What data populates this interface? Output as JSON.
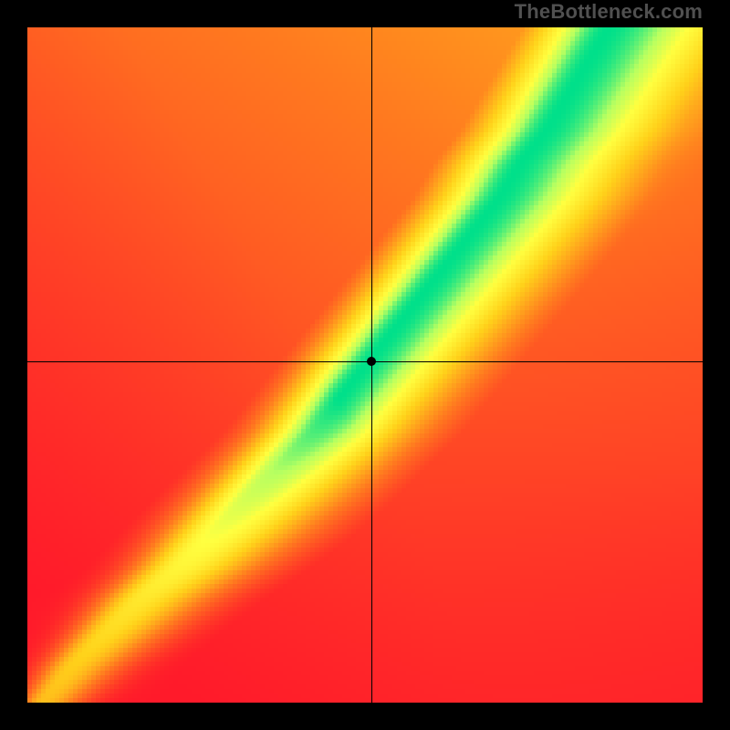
{
  "watermark": "TheBottleneck.com",
  "chart_data": {
    "type": "heatmap",
    "title": "",
    "xlabel": "",
    "ylabel": "",
    "xlim": [
      0,
      1
    ],
    "ylim": [
      0,
      1
    ],
    "crosshair": {
      "x": 0.51,
      "y": 0.505
    },
    "marker": {
      "x": 0.51,
      "y": 0.505
    },
    "grid": false,
    "legend": "none",
    "color_scale": {
      "stops": [
        {
          "value": 0.0,
          "color": "#FF1A2A"
        },
        {
          "value": 0.35,
          "color": "#FF7A1F"
        },
        {
          "value": 0.62,
          "color": "#FFD21A"
        },
        {
          "value": 0.8,
          "color": "#FFFF40"
        },
        {
          "value": 0.9,
          "color": "#B8FF60"
        },
        {
          "value": 1.0,
          "color": "#00E08A"
        }
      ]
    },
    "ridge": {
      "description": "Approximate center x of the green ridge as a function of y (0 at bottom, 1 at top)",
      "points": [
        {
          "y": 0.0,
          "x": 0.02,
          "width": 0.01
        },
        {
          "y": 0.05,
          "x": 0.06,
          "width": 0.015
        },
        {
          "y": 0.1,
          "x": 0.11,
          "width": 0.02
        },
        {
          "y": 0.15,
          "x": 0.16,
          "width": 0.025
        },
        {
          "y": 0.2,
          "x": 0.22,
          "width": 0.03
        },
        {
          "y": 0.25,
          "x": 0.27,
          "width": 0.035
        },
        {
          "y": 0.3,
          "x": 0.32,
          "width": 0.038
        },
        {
          "y": 0.35,
          "x": 0.37,
          "width": 0.04
        },
        {
          "y": 0.4,
          "x": 0.42,
          "width": 0.042
        },
        {
          "y": 0.45,
          "x": 0.46,
          "width": 0.044
        },
        {
          "y": 0.5,
          "x": 0.5,
          "width": 0.046
        },
        {
          "y": 0.55,
          "x": 0.54,
          "width": 0.048
        },
        {
          "y": 0.6,
          "x": 0.58,
          "width": 0.05
        },
        {
          "y": 0.65,
          "x": 0.62,
          "width": 0.052
        },
        {
          "y": 0.7,
          "x": 0.66,
          "width": 0.054
        },
        {
          "y": 0.75,
          "x": 0.7,
          "width": 0.056
        },
        {
          "y": 0.8,
          "x": 0.73,
          "width": 0.058
        },
        {
          "y": 0.85,
          "x": 0.77,
          "width": 0.06
        },
        {
          "y": 0.9,
          "x": 0.8,
          "width": 0.062
        },
        {
          "y": 0.95,
          "x": 0.83,
          "width": 0.064
        },
        {
          "y": 1.0,
          "x": 0.86,
          "width": 0.066
        }
      ]
    },
    "secondary_ridge": {
      "description": "Faint secondary yellow ridge to the right of the main ridge at upper values",
      "offset_x": 0.11,
      "start_y": 0.45,
      "intensity": 0.28
    }
  }
}
